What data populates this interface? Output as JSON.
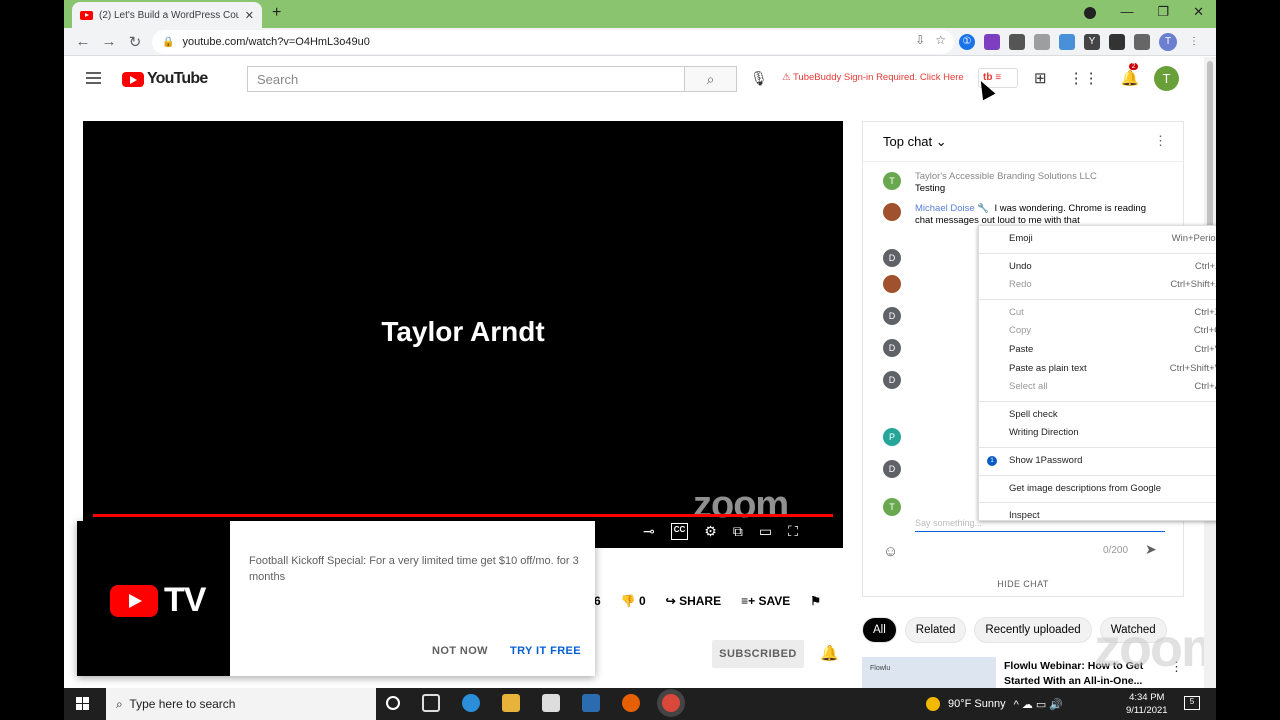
{
  "browser": {
    "tab_title": "(2) Let's Build a WordPress Course",
    "url": "youtube.com/watch?v=O4HmL3o49u0"
  },
  "youtube": {
    "logo_text": "YouTube",
    "search_placeholder": "Search",
    "tubebuddy_warning": "TubeBuddy Sign-in Required. Click Here",
    "notification_count": "2",
    "avatar_letter": "T"
  },
  "video": {
    "title_text": "Taylor Arndt",
    "watermark": "zoom",
    "like_count": "6",
    "dislike_count": "0",
    "share_label": "SHARE",
    "save_label": "SAVE",
    "subscribed_label": "SUBSCRIBED"
  },
  "popup": {
    "brand_tv": "TV",
    "message": "Football Kickoff Special: For a very limited time get $10 off/mo. for 3 months",
    "not_now": "NOT NOW",
    "try_free": "TRY IT FREE"
  },
  "chat": {
    "header": "Top chat",
    "messages": [
      {
        "avatar": "T",
        "author": "Taylor's Accessible Branding Solutions LLC",
        "text": "Testing"
      },
      {
        "author": "Michael Doise",
        "text": "I was wondering. Chrome is reading chat messages out loud to me with that"
      }
    ],
    "avatars": [
      "D",
      "D",
      "D",
      "D",
      "P",
      "D",
      "T"
    ],
    "input_placeholder": "Say something...",
    "char_count": "0/200",
    "hide_chat": "HIDE CHAT"
  },
  "context_menu": {
    "items": [
      {
        "label": "Emoji",
        "shortcut": "Win+Period"
      },
      {
        "label": "Undo",
        "shortcut": "Ctrl+Z"
      },
      {
        "label": "Redo",
        "shortcut": "Ctrl+Shift+Z"
      },
      {
        "label": "Cut",
        "shortcut": "Ctrl+X"
      },
      {
        "label": "Copy",
        "shortcut": "Ctrl+C"
      },
      {
        "label": "Paste",
        "shortcut": "Ctrl+V"
      },
      {
        "label": "Paste as plain text",
        "shortcut": "Ctrl+Shift+V"
      },
      {
        "label": "Select all",
        "shortcut": "Ctrl+A"
      },
      {
        "label": "Spell check",
        "shortcut": ""
      },
      {
        "label": "Writing Direction",
        "shortcut": ""
      },
      {
        "label": "Show 1Password",
        "shortcut": ""
      },
      {
        "label": "Get image descriptions from Google",
        "shortcut": ""
      },
      {
        "label": "Inspect",
        "shortcut": ""
      }
    ]
  },
  "chips": [
    "All",
    "Related",
    "Recently uploaded",
    "Watched"
  ],
  "related": {
    "thumb_label": "Flowlu",
    "title": "Flowlu Webinar: How to Get Started With an All-in-One..."
  },
  "taskbar": {
    "search_placeholder": "Type here to search",
    "weather": "90°F  Sunny",
    "time": "4:34 PM",
    "date": "9/11/2021",
    "notif_count": "5"
  }
}
